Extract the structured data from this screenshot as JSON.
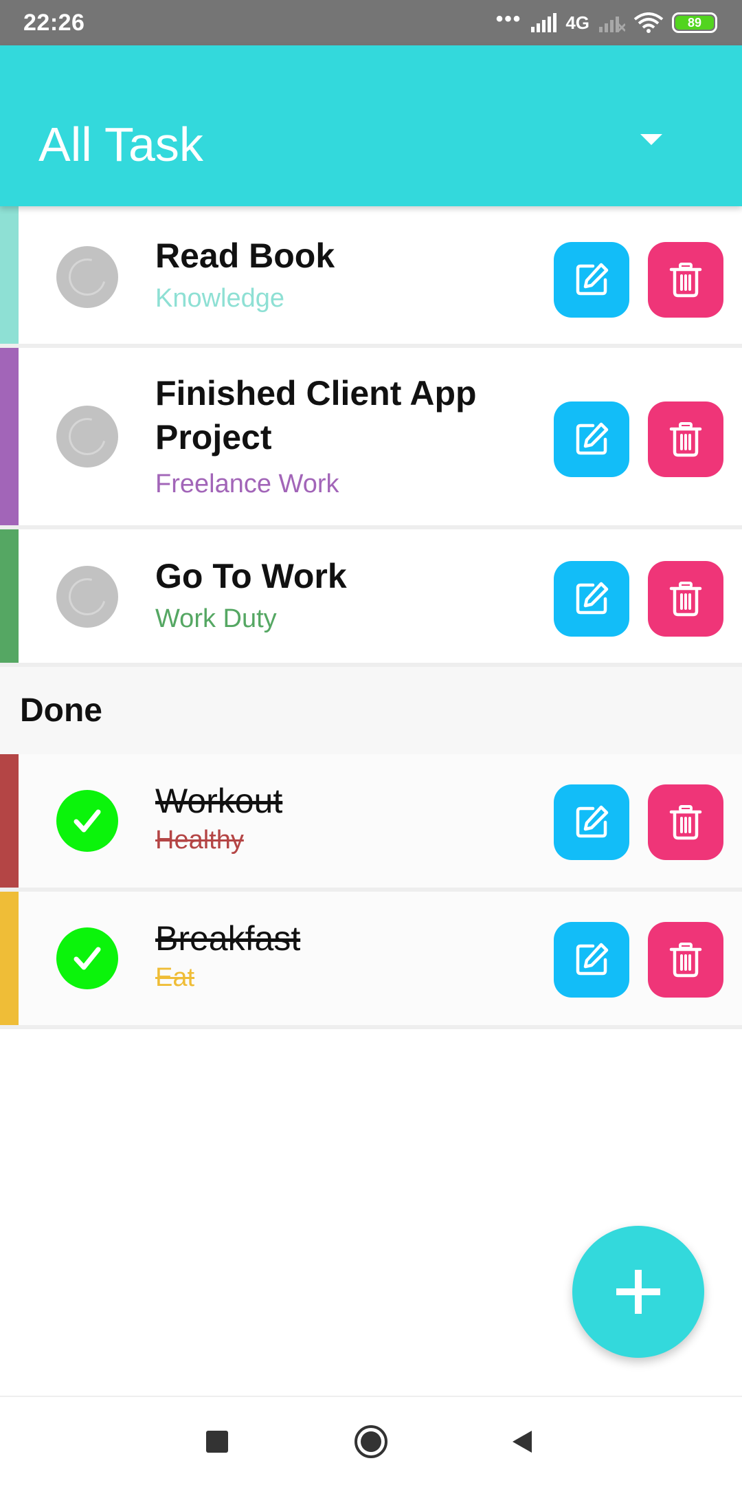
{
  "status_bar": {
    "time": "22:26",
    "dots": "•••",
    "network": "4G",
    "battery": "89",
    "icons": [
      "signal-icon",
      "signal-empty-icon",
      "wifi-icon",
      "battery-icon"
    ]
  },
  "app_bar": {
    "title": "All Task",
    "filter_icon": "chevron-down-icon"
  },
  "pending_tasks": [
    {
      "title": "Read Book",
      "category": "Knowledge",
      "color": "#8ee0d4",
      "category_color": "#8ee0d4"
    },
    {
      "title": "Finished Client App Project",
      "category": "Freelance Work",
      "color": "#a265b8",
      "category_color": "#a265b8"
    },
    {
      "title": "Go To Work",
      "category": "Work Duty",
      "color": "#55a763",
      "category_color": "#55a763"
    }
  ],
  "done_section": {
    "title": "Done"
  },
  "done_tasks": [
    {
      "title": "Workout",
      "category": "Healthy",
      "color": "#b44545",
      "category_color": "#b44545"
    },
    {
      "title": "Breakfast",
      "category": "Eat",
      "color": "#efbd37",
      "category_color": "#efbd37"
    }
  ],
  "actions": {
    "edit_icon": "edit-icon",
    "delete_icon": "trash-icon",
    "add_icon": "plus-icon"
  },
  "colors": {
    "accent": "#33d9dc",
    "edit": "#12bdf8",
    "delete": "#ef3578",
    "check": "#0bf40b",
    "pending_circle": "#c2c2c2"
  },
  "nav_bar": {
    "icons": [
      "recent-apps-icon",
      "home-icon",
      "back-icon"
    ]
  }
}
